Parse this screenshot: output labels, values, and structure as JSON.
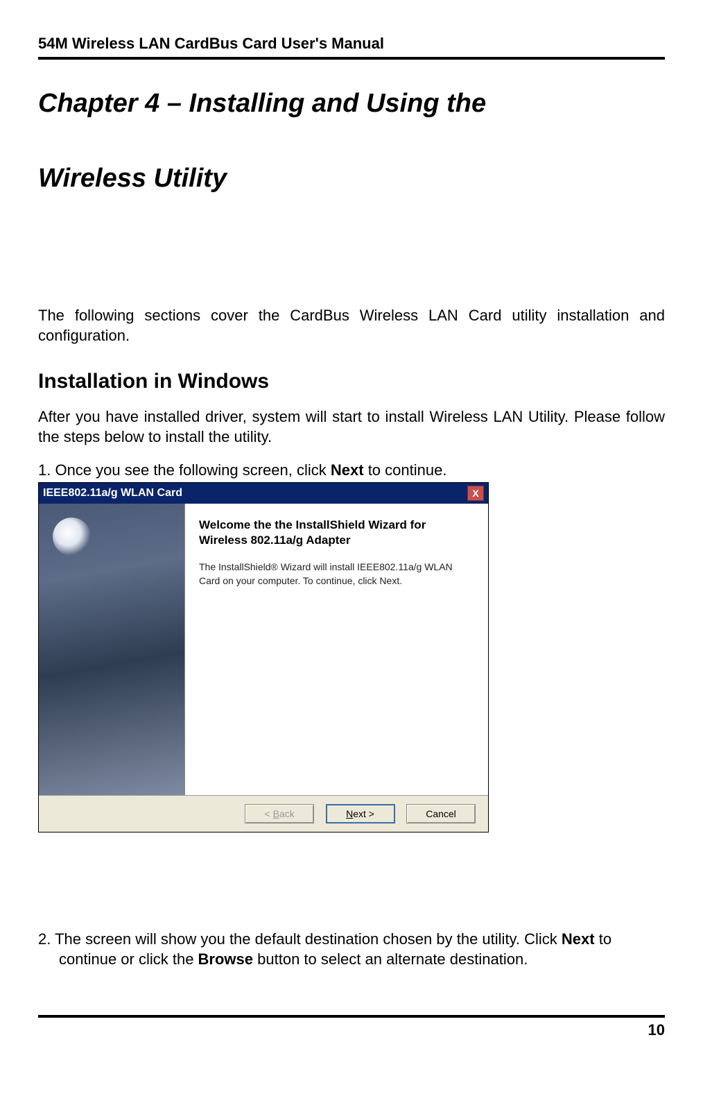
{
  "header": {
    "text": "54M Wireless LAN CardBus Card User's Manual"
  },
  "chapter": {
    "title_line1": "Chapter 4 – Installing and Using the",
    "title_line2": "Wireless Utility"
  },
  "intro": {
    "text": "The following sections cover the CardBus Wireless LAN Card utility installation and configuration."
  },
  "section": {
    "title": "Installation in Windows",
    "intro": "After you have installed driver, system will start to install Wireless LAN Utility. Please follow the steps below to install the utility."
  },
  "steps": {
    "s1_prefix": "1.  Once you see the following screen, click ",
    "s1_bold": "Next",
    "s1_suffix": " to continue.",
    "s2_prefix": "2.  The screen will show you the default destination chosen by the utility. Click ",
    "s2_bold1": "Next",
    "s2_mid": " to continue or click the ",
    "s2_bold2": "Browse",
    "s2_suffix": " button to select an alternate destination."
  },
  "dialog": {
    "title": "IEEE802.11a/g WLAN Card",
    "heading": "Welcome the the InstallShield Wizard for Wireless 802.11a/g Adapter",
    "body": "The InstallShield® Wizard will install IEEE802.11a/g WLAN Card on your computer.  To continue, click Next.",
    "buttons": {
      "back_lt": "< ",
      "back_u": "B",
      "back_rest": "ack",
      "next_u": "N",
      "next_rest": "ext >",
      "cancel": "Cancel"
    }
  },
  "page_number": "10"
}
